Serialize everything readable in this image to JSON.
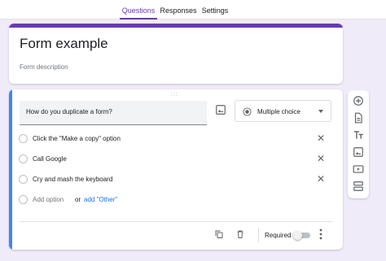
{
  "tabs": [
    {
      "label": "Questions",
      "active": true
    },
    {
      "label": "Responses",
      "active": false
    },
    {
      "label": "Settings",
      "active": false
    }
  ],
  "form": {
    "title": "Form example",
    "description": "Form description"
  },
  "question": {
    "text": "How do you duplicate a form?",
    "type": "Multiple choice",
    "options": [
      "Click the \"Make a copy\" option",
      "Call Google",
      "Cry and mash the keyboard"
    ],
    "add_option": "Add option",
    "or": "or",
    "add_other": "add \"Other\"",
    "required_label": "Required",
    "required": false
  },
  "drag_handle": ":::",
  "icons": {
    "image": "image-icon",
    "radio": "radio-button-icon",
    "dropdown": "chevron-down-icon",
    "remove_option": "close-icon",
    "duplicate": "duplicate-icon",
    "delete": "trash-icon",
    "more": "more-vert-icon",
    "sidebar": [
      "add-circle-icon",
      "import-question-icon",
      "add-title-icon",
      "add-image-icon",
      "add-video-icon",
      "add-section-icon"
    ]
  },
  "colors": {
    "accent": "#673ab7",
    "background": "#f0ebf8",
    "active_question_bar": "#4285f4",
    "link": "#1a73e8"
  }
}
